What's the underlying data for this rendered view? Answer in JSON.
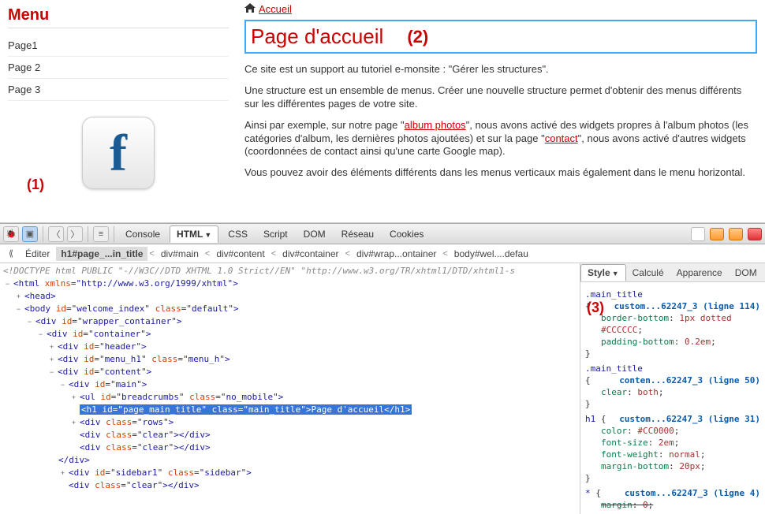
{
  "annotations": {
    "one": "(1)",
    "two": "(2)",
    "three": "(3)"
  },
  "sidebar": {
    "title": "Menu",
    "items": [
      "Page1",
      "Page 2",
      "Page 3"
    ]
  },
  "breadcrumb": {
    "home": "Accueil"
  },
  "page_title": "Page d'accueil",
  "paragraphs": {
    "p1": "Ce site est un support au tutoriel e-monsite : \"Gérer les structures\".",
    "p2": "Une structure est un ensemble de menus. Créer une nouvelle structure permet d'obtenir des menus différents sur les différentes pages de votre site.",
    "p3a": "Ainsi par exemple, sur notre page \"",
    "p3link1": "album photos",
    "p3b": "\", nous avons activé des widgets propres à l'album photos (les catégories d'album, les dernières photos ajoutées) et sur la page \"",
    "p3link2": "contact",
    "p3c": "\", nous avons activé d'autres widgets (coordonnées de contact ainsi qu'une carte Google map).",
    "p4": "Vous pouvez avoir des éléments différents dans les menus verticaux mais également dans le menu horizontal."
  },
  "devtools": {
    "tabs": {
      "console": "Console",
      "html": "HTML",
      "css": "CSS",
      "script": "Script",
      "dom": "DOM",
      "reseau": "Réseau",
      "cookies": "Cookies"
    },
    "crumb": {
      "editer": "Éditer",
      "h1": "h1#page_...in_title",
      "divmain": "div#main",
      "divcontent": "div#content",
      "divcontainer": "div#container",
      "divwrap": "div#wrap...ontainer",
      "body": "body#wel....defau"
    },
    "side_tabs": {
      "style": "Style",
      "calcule": "Calculé",
      "apparence": "Apparence",
      "dom": "DOM"
    },
    "src": {
      "doctype": "<!DOCTYPE html PUBLIC \"-//W3C//DTD XHTML 1.0 Strict//EN\" \"http://www.w3.org/TR/xhtml1/DTD/xhtml1-s",
      "html_open": "<html xmlns=\"http://www.w3.org/1999/xhtml\">",
      "head": "<head>",
      "body_open_a": "<body id=\"",
      "body_id": "welcome_index",
      "body_open_b": "\" class=\"",
      "body_class": "default",
      "body_open_c": "\">",
      "wrap_a": "<div id=\"",
      "wrap_id": "wrapper_container",
      "wrap_b": "\">",
      "cont_a": "<div id=\"",
      "cont_id": "container",
      "cont_b": "\">",
      "header_a": "<div id=\"",
      "header_id": "header",
      "header_b": "\">",
      "menu_a": "<div id=\"",
      "menu_id": "menu_h1",
      "menu_b": "\" class=\"",
      "menu_class": "menu_h",
      "menu_c": "\">",
      "content_a": "<div id=\"",
      "content_id": "content",
      "content_b": "\">",
      "main_a": "<div id=\"",
      "main_id": "main",
      "main_b": "\">",
      "bc_a": "<ul id=\"",
      "bc_id": "breadcrumbs",
      "bc_b": "\" class=\"",
      "bc_class": "no_mobile",
      "bc_c": "\">",
      "h1_a": "<h1 id=\"",
      "h1_id": "page_main_title",
      "h1_b": "\" class=\"",
      "h1_class": "main_title",
      "h1_c": "\">",
      "h1_text": "Page d'accueil",
      "h1_close": "</h1>",
      "rows_a": "<div class=\"",
      "rows_class": "rows",
      "rows_b": "\">",
      "clear_a": "<div class=\"",
      "clear_class": "clear",
      "clear_b": "\"></div>",
      "close_div": "</div>",
      "sidebar_a": "<div id=\"",
      "sidebar_id": "sidebar1",
      "sidebar_b": "\" class=\"",
      "sidebar_class": "sidebar",
      "sidebar_c": "\">"
    },
    "css": {
      "r1_sel": ".main_title",
      "r1_file": "custom...62247_3 (ligne 114)",
      "r1_p1": "border-bottom: 1px dotted #CCCCCC;",
      "r1_p2": "padding-bottom: 0.2em;",
      "r2_sel": ".main_title",
      "r2_file": "conten...62247_3 (ligne 50)",
      "r2_p1": "clear: both;",
      "r3_sel": "h1",
      "r3_file": "custom...62247_3 (ligne 31)",
      "r3_p1": "color: #CC0000;",
      "r3_p2": "font-size: 2em;",
      "r3_p3": "font-weight: normal;",
      "r3_p4": "margin-bottom: 20px;",
      "r4_sel": "*",
      "r4_file": "custom...62247_3 (ligne 4)",
      "r4_p1": "margin: 0;"
    }
  }
}
